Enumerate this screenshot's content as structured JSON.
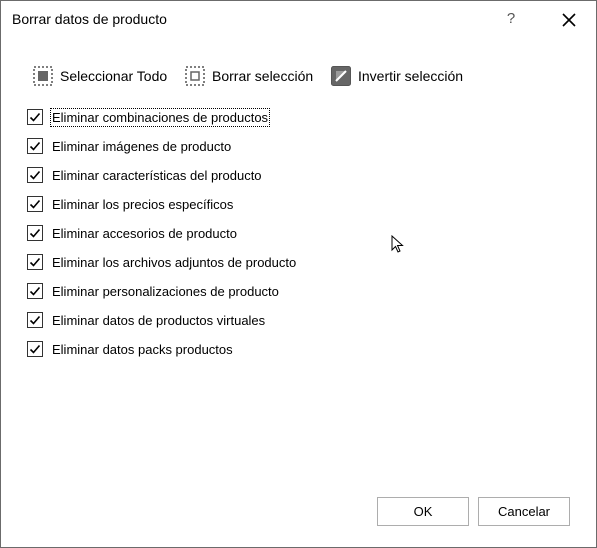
{
  "window": {
    "title": "Borrar datos de producto",
    "help_label": "?"
  },
  "toolbar": {
    "select_all": {
      "label": "Seleccionar Todo",
      "icon": "select-all-icon"
    },
    "clear_selection": {
      "label": "Borrar selección",
      "icon": "clear-selection-icon"
    },
    "invert_selection": {
      "label": "Invertir selección",
      "icon": "invert-selection-icon"
    }
  },
  "options": [
    {
      "label": "Eliminar combinaciones de productos",
      "checked": true
    },
    {
      "label": "Eliminar imágenes de producto",
      "checked": true
    },
    {
      "label": "Eliminar características del producto",
      "checked": true
    },
    {
      "label": "Eliminar los precios específicos",
      "checked": true
    },
    {
      "label": "Eliminar accesorios de producto",
      "checked": true
    },
    {
      "label": "Eliminar los archivos adjuntos de producto",
      "checked": true
    },
    {
      "label": "Eliminar personalizaciones de producto",
      "checked": true
    },
    {
      "label": "Eliminar datos de productos virtuales",
      "checked": true
    },
    {
      "label": "Eliminar datos packs productos",
      "checked": true
    }
  ],
  "buttons": {
    "ok": "OK",
    "cancel": "Cancelar"
  }
}
